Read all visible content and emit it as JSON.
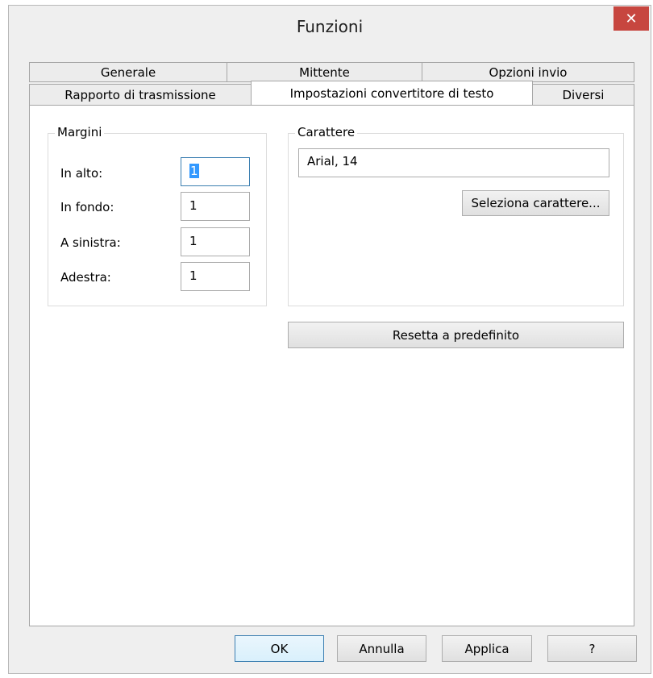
{
  "window": {
    "title": "Funzioni",
    "close_glyph": "✕"
  },
  "tabs_back": [
    "Generale",
    "Mittente",
    "Opzioni invio"
  ],
  "tabs_front": [
    "Rapporto di trasmissione",
    "Impostazioni convertitore di testo",
    "Diversi"
  ],
  "margins": {
    "legend": "Margini",
    "rows": [
      {
        "label": "In alto:",
        "value": "1"
      },
      {
        "label": "In fondo:",
        "value": "1"
      },
      {
        "label": "A sinistra:",
        "value": "1"
      },
      {
        "label": "Adestra:",
        "value": "1"
      }
    ]
  },
  "font": {
    "legend": "Carattere",
    "value": "Arial, 14",
    "select_button": "Seleziona carattere..."
  },
  "reset_button": "Resetta a predefinito",
  "footer": {
    "ok": "OK",
    "cancel": "Annulla",
    "apply": "Applica",
    "help": "?"
  }
}
